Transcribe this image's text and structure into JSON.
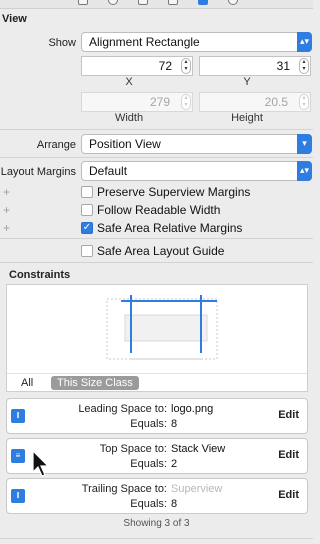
{
  "toolbar": {
    "icons": [
      "file-icon",
      "clock-icon",
      "identity-icon",
      "help-icon",
      "ruler-icon",
      "connections-icon"
    ],
    "selected": "ruler-icon"
  },
  "view": {
    "section_title": "View",
    "show_label": "Show",
    "show_value": "Alignment Rectangle",
    "x_value": "72",
    "y_value": "31",
    "x_label": "X",
    "y_label": "Y",
    "width_value": "279",
    "height_value": "20.5",
    "width_label": "Width",
    "height_label": "Height",
    "arrange_label": "Arrange",
    "arrange_value": "Position View",
    "margins_label": "Layout Margins",
    "margins_value": "Default",
    "checkboxes": [
      {
        "label": "Preserve Superview Margins",
        "checked": false
      },
      {
        "label": "Follow Readable Width",
        "checked": false
      },
      {
        "label": "Safe Area Relative Margins",
        "checked": true
      },
      {
        "label": "Safe Area Layout Guide",
        "checked": false
      }
    ]
  },
  "constraints": {
    "title": "Constraints",
    "filter_all": "All",
    "filter_size_class": "This Size Class",
    "items": [
      {
        "label": "Leading Space to:",
        "target": "logo.png",
        "equals_label": "Equals:",
        "equals_value": "8",
        "edit": "Edit",
        "icon": "leading-space-icon"
      },
      {
        "label": "Top Space to:",
        "target": "Stack View",
        "equals_label": "Equals:",
        "equals_value": "2",
        "edit": "Edit",
        "icon": "top-space-icon"
      },
      {
        "label": "Trailing Space to:",
        "target": "Superview",
        "equals_label": "Equals:",
        "equals_value": "8",
        "edit": "Edit",
        "icon": "trailing-space-icon"
      }
    ],
    "footer": "Showing 3 of 3"
  },
  "colors": {
    "accent": "#2f7de1",
    "background": "#ececec"
  }
}
